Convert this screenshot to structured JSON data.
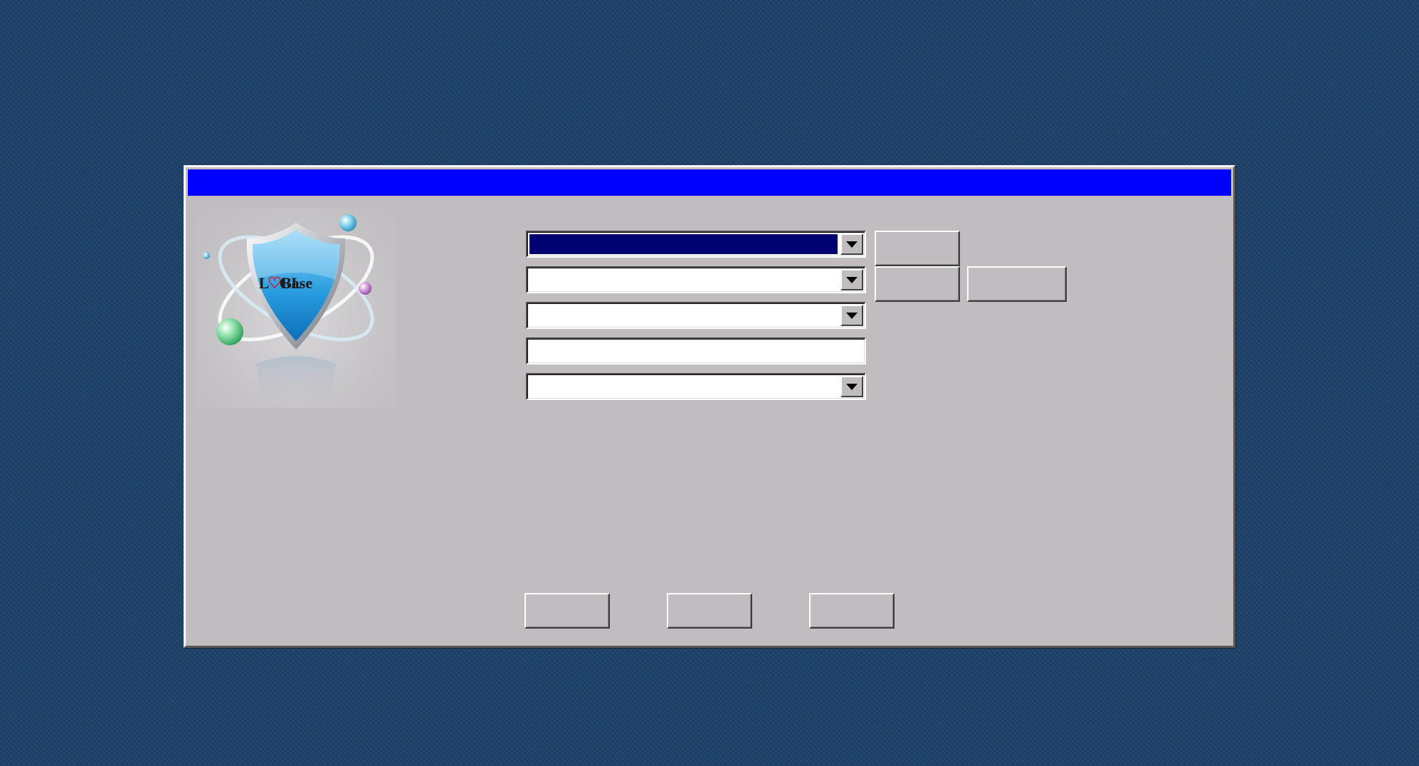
{
  "window": {
    "title": ""
  },
  "logo": {
    "brand_text": "LOGBase",
    "icon": "shield-atom-logo"
  },
  "form": {
    "combo1": {
      "value": "",
      "selected": true
    },
    "combo2": {
      "value": ""
    },
    "combo3": {
      "value": ""
    },
    "text_input": {
      "value": "",
      "placeholder": ""
    },
    "combo4": {
      "value": ""
    }
  },
  "side_buttons": {
    "button1_label": "",
    "button2_label": "",
    "button3_label": ""
  },
  "footer_buttons": {
    "button1_label": "",
    "button2_label": "",
    "button3_label": ""
  },
  "colors": {
    "desktop": "#1d416a",
    "titlebar": "#0000ff",
    "dialog_face": "#c0bcc0",
    "selection": "#000070"
  }
}
